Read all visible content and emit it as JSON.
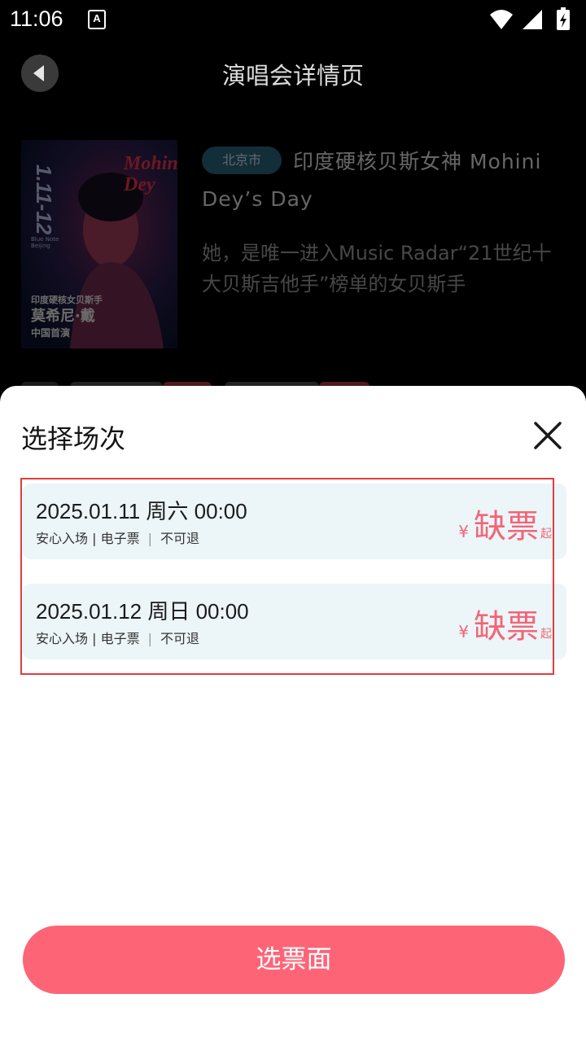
{
  "status_bar": {
    "time": "11:06",
    "notification_icon": "A",
    "icons": [
      "wifi-icon",
      "cell-signal-icon",
      "battery-charging-icon"
    ]
  },
  "header": {
    "title": "演唱会详情页",
    "back_icon": "back-arrow-icon"
  },
  "concert": {
    "city": "北京市",
    "title": "印度硬核贝斯女神 Mohini Dey’s Day",
    "description": "她，是唯一进入Music Radar“21世纪十大贝斯吉他手”榜单的女贝斯手",
    "poster": {
      "date_text": "1.11-12",
      "name_text": "Mohini Dey",
      "line1": "印度硬核女贝斯手",
      "line2": "莫希尼·戴",
      "line3": "中国首演",
      "venue": "Blue Note Beijing"
    }
  },
  "sheet": {
    "title": "选择场次",
    "close_icon": "close-icon",
    "sessions": [
      {
        "datetime": "2025.01.11 周六 00:00",
        "tag1": "安心入场 | 电子票",
        "tag2": "不可退",
        "currency": "¥",
        "status": "缺票",
        "suffix": "起"
      },
      {
        "datetime": "2025.01.12 周日 00:00",
        "tag1": "安心入场 | 电子票",
        "tag2": "不可退",
        "currency": "¥",
        "status": "缺票",
        "suffix": "起"
      }
    ],
    "select_button": "选票面"
  },
  "colors": {
    "accent": "#fd6577",
    "price": "#f26578",
    "city_badge": "#2d6e86",
    "session_bg": "#ecf5f7",
    "highlight_border": "#e23c3c"
  }
}
